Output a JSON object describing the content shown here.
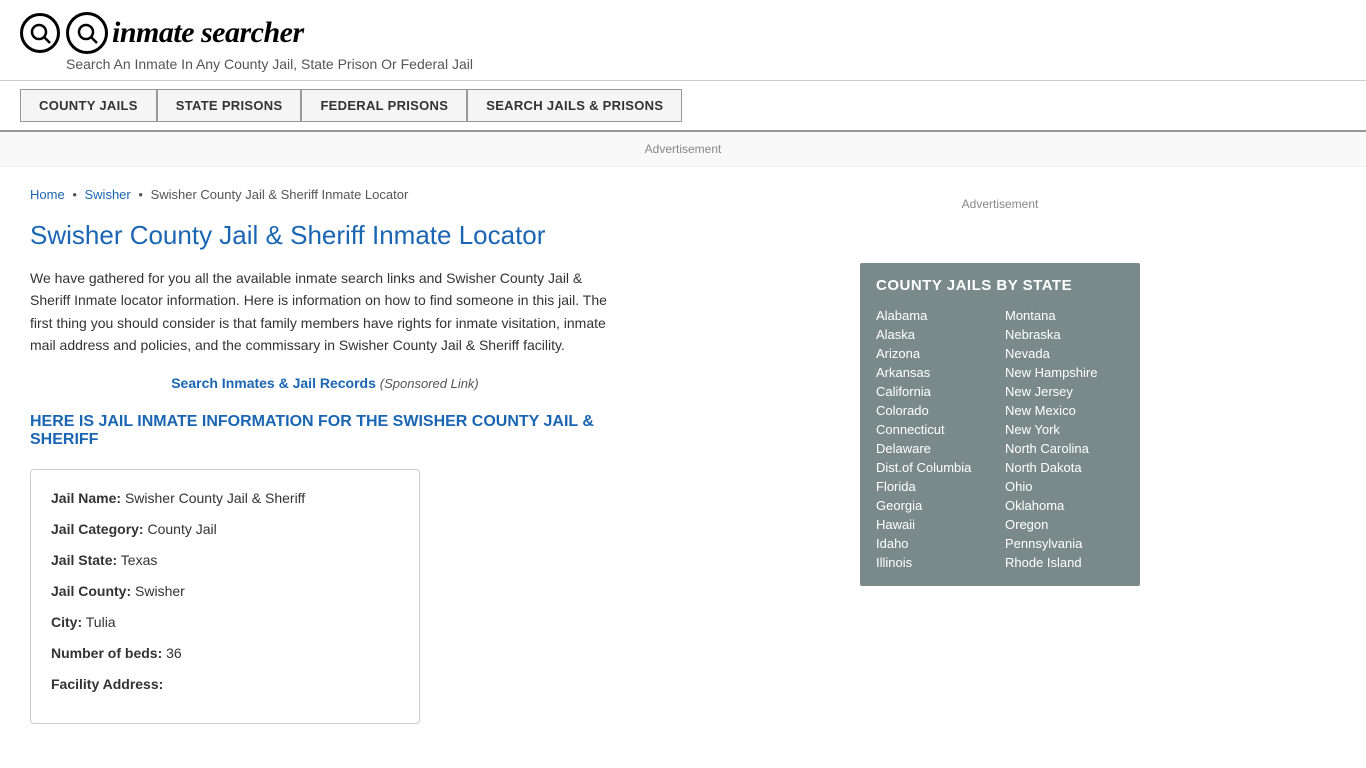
{
  "header": {
    "logo_icon": "🔍",
    "logo_text": "inmate searcher",
    "tagline": "Search An Inmate In Any County Jail, State Prison Or Federal Jail"
  },
  "nav": {
    "items": [
      {
        "label": "COUNTY JAILS",
        "id": "county-jails"
      },
      {
        "label": "STATE PRISONS",
        "id": "state-prisons"
      },
      {
        "label": "FEDERAL PRISONS",
        "id": "federal-prisons"
      },
      {
        "label": "SEARCH JAILS & PRISONS",
        "id": "search-jails"
      }
    ]
  },
  "ad_banner": "Advertisement",
  "breadcrumb": {
    "home": "Home",
    "parent": "Swisher",
    "current": "Swisher County Jail & Sheriff Inmate Locator"
  },
  "page_title": "Swisher County Jail & Sheriff Inmate Locator",
  "description": "We have gathered for you all the available inmate search links and Swisher County Jail & Sheriff Inmate locator information. Here is information on how to find someone in this jail. The first thing you should consider is that family members have rights for inmate visitation, inmate mail address and policies, and the commissary in Swisher County Jail & Sheriff facility.",
  "sponsored": {
    "link_text": "Search Inmates & Jail Records",
    "note": "(Sponsored Link)"
  },
  "section_heading": "HERE IS JAIL INMATE INFORMATION FOR THE SWISHER COUNTY JAIL & SHERIFF",
  "jail_info": {
    "name_label": "Jail Name:",
    "name_value": "Swisher County Jail & Sheriff",
    "category_label": "Jail Category:",
    "category_value": "County Jail",
    "state_label": "Jail State:",
    "state_value": "Texas",
    "county_label": "Jail County:",
    "county_value": "Swisher",
    "city_label": "City:",
    "city_value": "Tulia",
    "beds_label": "Number of beds:",
    "beds_value": "36",
    "address_label": "Facility Address:"
  },
  "sidebar": {
    "ad_label": "Advertisement",
    "state_box_title": "COUNTY JAILS BY STATE",
    "states_left": [
      "Alabama",
      "Alaska",
      "Arizona",
      "Arkansas",
      "California",
      "Colorado",
      "Connecticut",
      "Delaware",
      "Dist.of Columbia",
      "Florida",
      "Georgia",
      "Hawaii",
      "Idaho",
      "Illinois"
    ],
    "states_right": [
      "Montana",
      "Nebraska",
      "Nevada",
      "New Hampshire",
      "New Jersey",
      "New Mexico",
      "New York",
      "North Carolina",
      "North Dakota",
      "Ohio",
      "Oklahoma",
      "Oregon",
      "Pennsylvania",
      "Rhode Island"
    ]
  }
}
